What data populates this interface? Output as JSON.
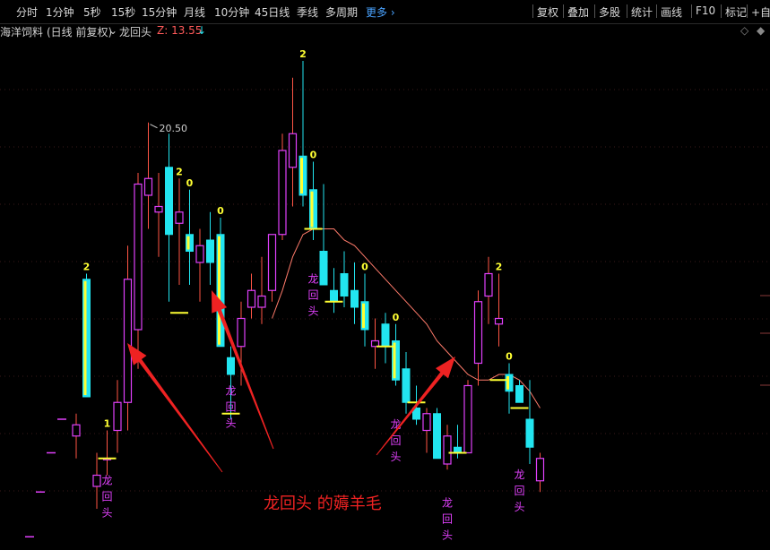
{
  "toolbar": {
    "periods": [
      "分时",
      "1分钟",
      "5秒",
      "15秒",
      "15分钟",
      "月线",
      "10分钟",
      "45日线",
      "季线",
      "多周期"
    ],
    "more": "更多",
    "right_buttons": [
      "复权",
      "叠加",
      "多股",
      "统计",
      "画线",
      "F10",
      "标记",
      "+自"
    ]
  },
  "title": {
    "stock": "海洋饲料",
    "mode": "(日线 前复权)",
    "indicator": "龙回头",
    "z_label": "Z: 13.55",
    "arrow": "↓"
  },
  "colors": {
    "up": "#e040fb",
    "down": "#22e5f0",
    "yellow": "#ffff33",
    "ma": "#ff7b6b",
    "wick_up": "#ff5545",
    "arrow_red": "#ee2222",
    "text_magenta": "#e040fb"
  },
  "chart_data": {
    "type": "candlestick",
    "high_label": "20.50",
    "candles": [
      {
        "o": 14.9,
        "h": 15.3,
        "l": 14.5,
        "c": 15.1
      },
      {
        "o": 17.7,
        "h": 17.8,
        "l": 15.6,
        "c": 15.6,
        "label": "2"
      },
      {
        "o": 14.0,
        "h": 14.6,
        "l": 13.6,
        "c": 14.2
      },
      {
        "o": 14.5,
        "h": 15.0,
        "l": 14.2,
        "c": 14.5,
        "label": "1"
      },
      {
        "o": 15.0,
        "h": 15.9,
        "l": 14.6,
        "c": 15.5
      },
      {
        "o": 15.5,
        "h": 18.3,
        "l": 15.0,
        "c": 17.7
      },
      {
        "o": 16.8,
        "h": 19.6,
        "l": 16.1,
        "c": 19.4
      },
      {
        "o": 19.2,
        "h": 20.5,
        "l": 18.6,
        "c": 19.5
      },
      {
        "o": 18.9,
        "h": 19.6,
        "l": 18.1,
        "c": 19.0
      },
      {
        "o": 19.7,
        "h": 20.3,
        "l": 17.3,
        "c": 18.5
      },
      {
        "o": 18.7,
        "h": 19.5,
        "l": 17.6,
        "c": 18.9,
        "label": "2"
      },
      {
        "o": 18.5,
        "h": 19.3,
        "l": 17.6,
        "c": 18.2,
        "label": "0"
      },
      {
        "o": 18.0,
        "h": 18.6,
        "l": 17.3,
        "c": 18.3
      },
      {
        "o": 18.4,
        "h": 18.9,
        "l": 17.6,
        "c": 18.0
      },
      {
        "o": 18.5,
        "h": 18.8,
        "l": 16.8,
        "c": 16.5,
        "label": "0"
      },
      {
        "o": 16.3,
        "h": 16.5,
        "l": 15.2,
        "c": 16.0
      },
      {
        "o": 16.5,
        "h": 17.3,
        "l": 15.8,
        "c": 17.0
      },
      {
        "o": 17.2,
        "h": 17.8,
        "l": 17.0,
        "c": 17.5
      },
      {
        "o": 17.2,
        "h": 18.1,
        "l": 16.9,
        "c": 17.4
      },
      {
        "o": 17.5,
        "h": 18.2,
        "l": 17.3,
        "c": 18.5
      },
      {
        "o": 18.5,
        "h": 20.3,
        "l": 18.4,
        "c": 20.0
      },
      {
        "o": 19.7,
        "h": 21.3,
        "l": 19.0,
        "c": 20.3
      },
      {
        "o": 19.9,
        "h": 21.6,
        "l": 19.0,
        "c": 19.2,
        "label": "2"
      },
      {
        "o": 19.3,
        "h": 19.8,
        "l": 18.4,
        "c": 18.6,
        "label": "0"
      },
      {
        "o": 18.2,
        "h": 19.4,
        "l": 17.6,
        "c": 17.6
      },
      {
        "o": 17.5,
        "h": 17.9,
        "l": 17.1,
        "c": 17.3
      },
      {
        "o": 17.8,
        "h": 18.2,
        "l": 17.2,
        "c": 17.4
      },
      {
        "o": 17.5,
        "h": 18.0,
        "l": 16.9,
        "c": 17.2
      },
      {
        "o": 17.3,
        "h": 17.8,
        "l": 16.5,
        "c": 16.8,
        "label": "0"
      },
      {
        "o": 16.5,
        "h": 17.0,
        "l": 16.1,
        "c": 16.6
      },
      {
        "o": 16.9,
        "h": 17.1,
        "l": 16.2,
        "c": 16.5
      },
      {
        "o": 16.6,
        "h": 16.9,
        "l": 15.8,
        "c": 15.9,
        "label": "0"
      },
      {
        "o": 16.1,
        "h": 16.4,
        "l": 15.3,
        "c": 15.5
      },
      {
        "o": 15.4,
        "h": 15.8,
        "l": 15.1,
        "c": 15.2
      },
      {
        "o": 15.0,
        "h": 15.4,
        "l": 14.6,
        "c": 15.3
      },
      {
        "o": 15.3,
        "h": 15.4,
        "l": 14.5,
        "c": 14.5
      },
      {
        "o": 14.4,
        "h": 15.1,
        "l": 14.3,
        "c": 14.9
      },
      {
        "o": 14.7,
        "h": 15.1,
        "l": 14.5,
        "c": 14.6
      },
      {
        "o": 14.6,
        "h": 15.9,
        "l": 14.6,
        "c": 15.8
      },
      {
        "o": 16.2,
        "h": 17.5,
        "l": 15.8,
        "c": 17.3
      },
      {
        "o": 17.4,
        "h": 18.1,
        "l": 16.9,
        "c": 17.8
      },
      {
        "o": 16.9,
        "h": 17.8,
        "l": 16.5,
        "c": 17.0,
        "label": "2"
      },
      {
        "o": 16.0,
        "h": 16.2,
        "l": 15.3,
        "c": 15.7,
        "label": "0"
      },
      {
        "o": 15.8,
        "h": 15.9,
        "l": 15.5,
        "c": 15.5
      },
      {
        "o": 15.2,
        "h": 15.9,
        "l": 14.4,
        "c": 14.7
      },
      {
        "o": 14.1,
        "h": 14.6,
        "l": 13.9,
        "c": 14.5
      }
    ],
    "ma": [
      null,
      null,
      null,
      null,
      null,
      null,
      null,
      null,
      null,
      null,
      null,
      null,
      null,
      null,
      null,
      null,
      null,
      null,
      null,
      17.0,
      17.5,
      18.1,
      18.5,
      18.6,
      18.6,
      18.6,
      18.4,
      18.3,
      18.1,
      17.9,
      17.7,
      17.5,
      17.3,
      17.1,
      16.9,
      16.6,
      16.4,
      16.2,
      16.0,
      15.9,
      15.9,
      16.0,
      16.0,
      15.9,
      15.7,
      15.4
    ],
    "yellow_ticks": [
      {
        "i": 3,
        "v": 14.5
      },
      {
        "i": 10,
        "v": 17.1
      },
      {
        "i": 15,
        "v": 15.3
      },
      {
        "i": 23,
        "v": 18.6
      },
      {
        "i": 25,
        "v": 17.3
      },
      {
        "i": 30,
        "v": 16.5
      },
      {
        "i": 33,
        "v": 15.5
      },
      {
        "i": 37,
        "v": 14.6
      },
      {
        "i": 41,
        "v": 15.9
      },
      {
        "i": 43,
        "v": 15.4
      }
    ],
    "side_marks": [
      15.2,
      14.6,
      13.9,
      13.1,
      12.5,
      11.6
    ]
  },
  "annotations": {
    "markers": [
      {
        "chars": [
          "龙",
          "回",
          "头"
        ],
        "i": 3,
        "v": 14.3
      },
      {
        "chars": [
          "龙",
          "回",
          "头"
        ],
        "i": 15,
        "v": 15.9
      },
      {
        "chars": [
          "龙",
          "回",
          "头"
        ],
        "i": 23,
        "v": 17.9
      },
      {
        "chars": [
          "龙",
          "回",
          "头"
        ],
        "i": 31,
        "v": 15.3
      },
      {
        "chars": [
          "龙",
          "回",
          "头"
        ],
        "i": 36,
        "v": 13.9
      },
      {
        "chars": [
          "龙",
          "回",
          "头"
        ],
        "i": 43,
        "v": 14.4
      }
    ],
    "caption": "龙回头 的薅羊毛"
  }
}
